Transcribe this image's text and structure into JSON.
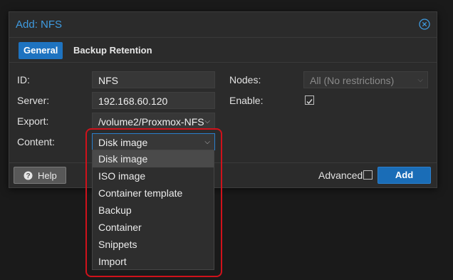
{
  "dialog": {
    "title": "Add: NFS",
    "close_icon": "close-circle-icon",
    "accent_color": "#3f9be0"
  },
  "tabs": [
    {
      "label": "General",
      "active": true
    },
    {
      "label": "Backup Retention",
      "active": false
    }
  ],
  "form": {
    "id_label": "ID:",
    "id_value": "NFS",
    "server_label": "Server:",
    "server_value": "192.168.60.120",
    "export_label": "Export:",
    "export_value": "/volume2/Proxmox-NFS",
    "content_label": "Content:",
    "content_value": "Disk image",
    "nodes_label": "Nodes:",
    "nodes_value": "All (No restrictions)",
    "enable_label": "Enable:",
    "enable_checked": true
  },
  "content_dropdown": {
    "options": [
      "Disk image",
      "ISO image",
      "Container template",
      "Backup",
      "Container",
      "Snippets",
      "Import"
    ],
    "selected": "Disk image"
  },
  "footer": {
    "help_label": "Help",
    "help_icon": "question-circle-icon",
    "advanced_label": "Advanced",
    "advanced_checked": false,
    "add_label": "Add",
    "add_color": "#1a6db7"
  },
  "annotation": {
    "highlight_color": "#d0121b"
  }
}
